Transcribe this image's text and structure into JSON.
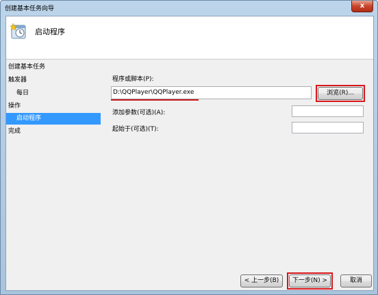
{
  "window": {
    "title": "创建基本任务向导",
    "close_label": "x"
  },
  "header": {
    "title": "启动程序",
    "icon": "task-wizard-icon"
  },
  "sidebar": {
    "items": [
      {
        "label": "创建基本任务"
      },
      {
        "label": "触发器"
      },
      {
        "label": "每日"
      },
      {
        "label": "操作"
      },
      {
        "label": "启动程序"
      },
      {
        "label": "完成"
      }
    ]
  },
  "form": {
    "program_label": "程序或脚本(P):",
    "program_value": "D:\\QQPlayer\\QQPlayer.exe",
    "browse_label": "浏览(R)...",
    "args_label": "添加参数(可选)(A):",
    "args_value": "",
    "start_in_label": "起始于(可选)(T):",
    "start_in_value": ""
  },
  "buttons": {
    "back": "< 上一步(B)",
    "next": "下一步(N) >",
    "cancel": "取消"
  },
  "colors": {
    "accent": "#3399ff",
    "highlight": "#d9141b"
  }
}
